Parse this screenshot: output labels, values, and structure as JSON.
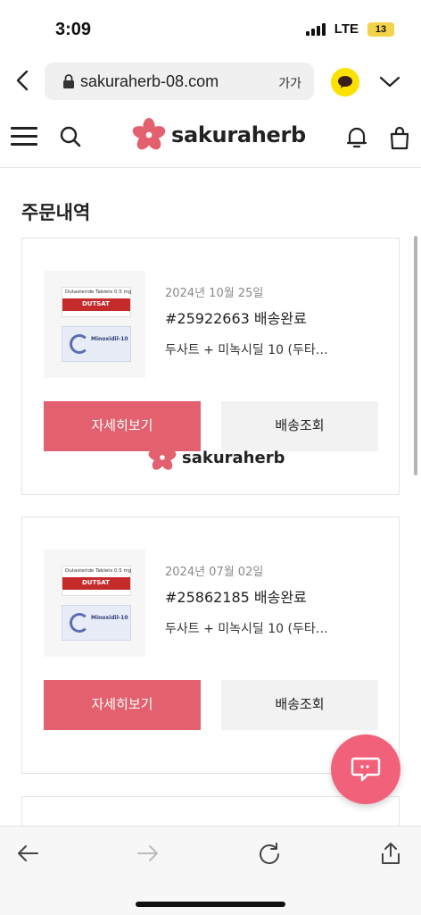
{
  "status_bar": {
    "time": "3:09",
    "network": "LTE",
    "battery": "13"
  },
  "browser": {
    "url": "sakuraherb-08.com",
    "font_size_label": "가가"
  },
  "site": {
    "logo_text": "sakuraherb",
    "brand_color": "#e3616f"
  },
  "page": {
    "title": "주문내역"
  },
  "orders": [
    {
      "date": "2024년 10월 25일",
      "number_status": "#25922663 배송완료",
      "items": "두사트 + 미녹시딜 10 (두타…",
      "product_top_label": "Dutasteride Tablets 0.5 mg",
      "product_top_brand": "DUTSAT",
      "product_bottom_brand": "Minoxidil-10",
      "detail_button": "자세히보기",
      "track_button": "배송조회"
    },
    {
      "date": "2024년 07월 02일",
      "number_status": "#25862185 배송완료",
      "items": "두사트 + 미녹시딜 10 (두타…",
      "product_top_label": "Dutasteride Tablets 0.5 mg",
      "product_top_brand": "DUTSAT",
      "product_bottom_brand": "Minoxidil-10",
      "detail_button": "자세히보기",
      "track_button": "배송조회"
    }
  ],
  "watermark": {
    "text": "sakuraherb"
  },
  "icons": {
    "back": "chevron-left-icon",
    "lock": "lock-icon",
    "kakao": "kakao-chat-icon",
    "expand": "chevron-down-icon",
    "menu": "hamburger-icon",
    "search": "search-icon",
    "bell": "bell-icon",
    "cart": "shopping-bag-icon",
    "chat": "chat-bubble-icon"
  }
}
